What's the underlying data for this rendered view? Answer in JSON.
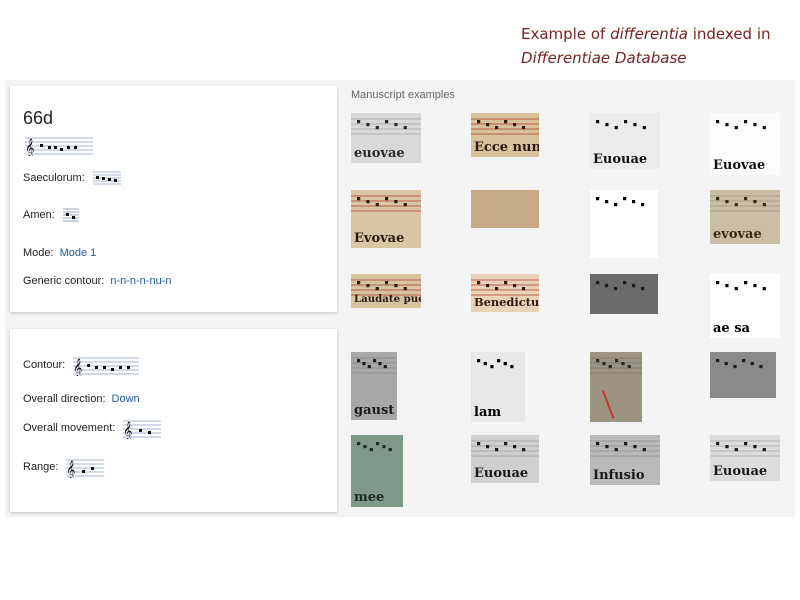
{
  "caption": {
    "line1_prefix": "Example of ",
    "line1_italic": "differentia",
    "line1_suffix": " indexed in",
    "line2_italic": "Differentiae Database"
  },
  "record": {
    "id": "66d",
    "saeculorum_label": "Saeculorum:",
    "amen_label": "Amen:",
    "mode_label": "Mode:",
    "mode_value": "Mode 1",
    "generic_contour_label": "Generic contour:",
    "generic_contour_value": "n-n-n-n-nu-n"
  },
  "analysis": {
    "contour_label": "Contour:",
    "direction_label": "Overall direction:",
    "direction_value": "Down",
    "movement_label": "Overall movement:",
    "range_label": "Range:"
  },
  "manuscripts": {
    "header": "Manuscript examples",
    "thumbnails": [
      {
        "name": "ms-thumb-1",
        "bg": "#d9d9d9",
        "ink": "#2a2a2a",
        "text": "euovae",
        "style": "gray"
      },
      {
        "name": "ms-thumb-2",
        "bg": "#d8c29a",
        "ink": "#2b1b10",
        "text": "Ecce nunc",
        "style": "red-lines"
      },
      {
        "name": "ms-thumb-3",
        "bg": "#ececec",
        "ink": "#111111",
        "text": "Euouae",
        "style": "bw"
      },
      {
        "name": "ms-thumb-4",
        "bg": "#fbfbfb",
        "ink": "#111111",
        "text": "Euovae",
        "style": "bw"
      },
      {
        "name": "ms-thumb-5",
        "bg": "#d9c6a2",
        "ink": "#2b1b10",
        "text": "Evovae",
        "style": "red-lines"
      },
      {
        "name": "ms-thumb-6",
        "bg": "#c6a884",
        "ink": "#6a5038",
        "text": "",
        "style": "blank"
      },
      {
        "name": "ms-thumb-7",
        "bg": "#ffffff",
        "ink": "#000000",
        "text": "",
        "style": "bw"
      },
      {
        "name": "ms-thumb-8",
        "bg": "#cbbfa3",
        "ink": "#3a2a1a",
        "text": "evovae",
        "style": "gray"
      },
      {
        "name": "ms-thumb-9",
        "bg": "#d6c49e",
        "ink": "#2b1b10",
        "text": "Laudate pue",
        "style": "red-lines"
      },
      {
        "name": "ms-thumb-10",
        "bg": "#ead2b8",
        "ink": "#2b1b10",
        "text": "Benedictus",
        "style": "red-lines"
      },
      {
        "name": "ms-thumb-11",
        "bg": "#6b6b6b",
        "ink": "#1a1a1a",
        "text": "",
        "style": "dark"
      },
      {
        "name": "ms-thumb-12",
        "bg": "#ffffff",
        "ink": "#000000",
        "text": "ae sa",
        "style": "bw"
      },
      {
        "name": "ms-thumb-13",
        "bg": "#a8a8a8",
        "ink": "#1a1a1a",
        "text": "gaust",
        "style": "gray"
      },
      {
        "name": "ms-thumb-14",
        "bg": "#e8e8e8",
        "ink": "#000000",
        "text": "lam",
        "style": "bw"
      },
      {
        "name": "ms-thumb-15",
        "bg": "#9c9380",
        "ink": "#2a2a2a",
        "text": "",
        "style": "red-accent"
      },
      {
        "name": "ms-thumb-16",
        "bg": "#8a8a8a",
        "ink": "#1a1a1a",
        "text": "",
        "style": "dark"
      },
      {
        "name": "ms-thumb-17",
        "bg": "#7e9a86",
        "ink": "#1e2a22",
        "text": "mee",
        "style": "green"
      },
      {
        "name": "ms-thumb-18",
        "bg": "#cfcfcf",
        "ink": "#1a1a1a",
        "text": "Euouae",
        "style": "gray"
      },
      {
        "name": "ms-thumb-19",
        "bg": "#b9b9b9",
        "ink": "#1a1a1a",
        "text": "Infusio",
        "style": "gray"
      },
      {
        "name": "ms-thumb-20",
        "bg": "#dcdcdc",
        "ink": "#1a1a1a",
        "text": "Euouae",
        "style": "gray"
      }
    ]
  },
  "colors": {
    "caption": "#7a1f1f",
    "link": "#1f5aa6",
    "staff_line": "#4a6fa5"
  }
}
